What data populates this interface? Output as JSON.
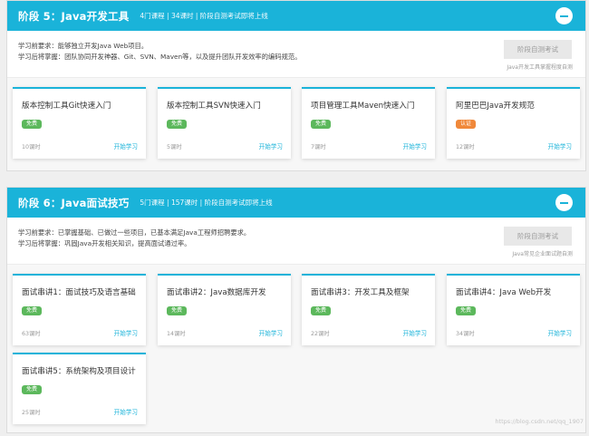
{
  "stages": [
    {
      "title": "阶段 5：Java开发工具",
      "meta": "4门课程 | 34课时 | 阶段自测考试即将上线",
      "prereq": "学习前要求：能够独立开发Java Web项目。",
      "outcome": "学习后将掌握：团队协同开发神器、Git、SVN、Maven等，以及提升团队开发效率的编码规范。",
      "exam_label": "阶段自测考试",
      "exam_note": "Java开发工具掌握程度自测",
      "courses": [
        {
          "title": "版本控制工具Git快速入门",
          "badge": "免费",
          "badge_type": "free",
          "hours": "10课时",
          "action": "开始学习"
        },
        {
          "title": "版本控制工具SVN快速入门",
          "badge": "免费",
          "badge_type": "free",
          "hours": "5课时",
          "action": "开始学习"
        },
        {
          "title": "项目管理工具Maven快速入门",
          "badge": "免费",
          "badge_type": "free",
          "hours": "7课时",
          "action": "开始学习"
        },
        {
          "title": "阿里巴巴Java开发规范",
          "badge": "认证",
          "badge_type": "cert",
          "hours": "12课时",
          "action": "开始学习"
        }
      ]
    },
    {
      "title": "阶段 6：Java面试技巧",
      "meta": "5门课程 | 157课时 | 阶段自测考试即将上线",
      "prereq": "学习前要求：已掌握基础、已做过一些项目，已基本满足Java工程师招聘要求。",
      "outcome": "学习后将掌握：巩固Java开发相关知识，提高面试通过率。",
      "exam_label": "阶段自测考试",
      "exam_note": "Java常见企业面试题自测",
      "courses": [
        {
          "title": "面试串讲1：面试技巧及语言基础",
          "badge": "免费",
          "badge_type": "free",
          "hours": "63课时",
          "action": "开始学习"
        },
        {
          "title": "面试串讲2：Java数据库开发",
          "badge": "免费",
          "badge_type": "free",
          "hours": "14课时",
          "action": "开始学习"
        },
        {
          "title": "面试串讲3：开发工具及框架",
          "badge": "免费",
          "badge_type": "free",
          "hours": "22课时",
          "action": "开始学习"
        },
        {
          "title": "面试串讲4：Java Web开发",
          "badge": "免费",
          "badge_type": "free",
          "hours": "34课时",
          "action": "开始学习"
        },
        {
          "title": "面试串讲5：系统架构及项目设计",
          "badge": "免费",
          "badge_type": "free",
          "hours": "25课时",
          "action": "开始学习"
        }
      ]
    }
  ],
  "watermark": "https://blog.csdn.net/qq_1907"
}
